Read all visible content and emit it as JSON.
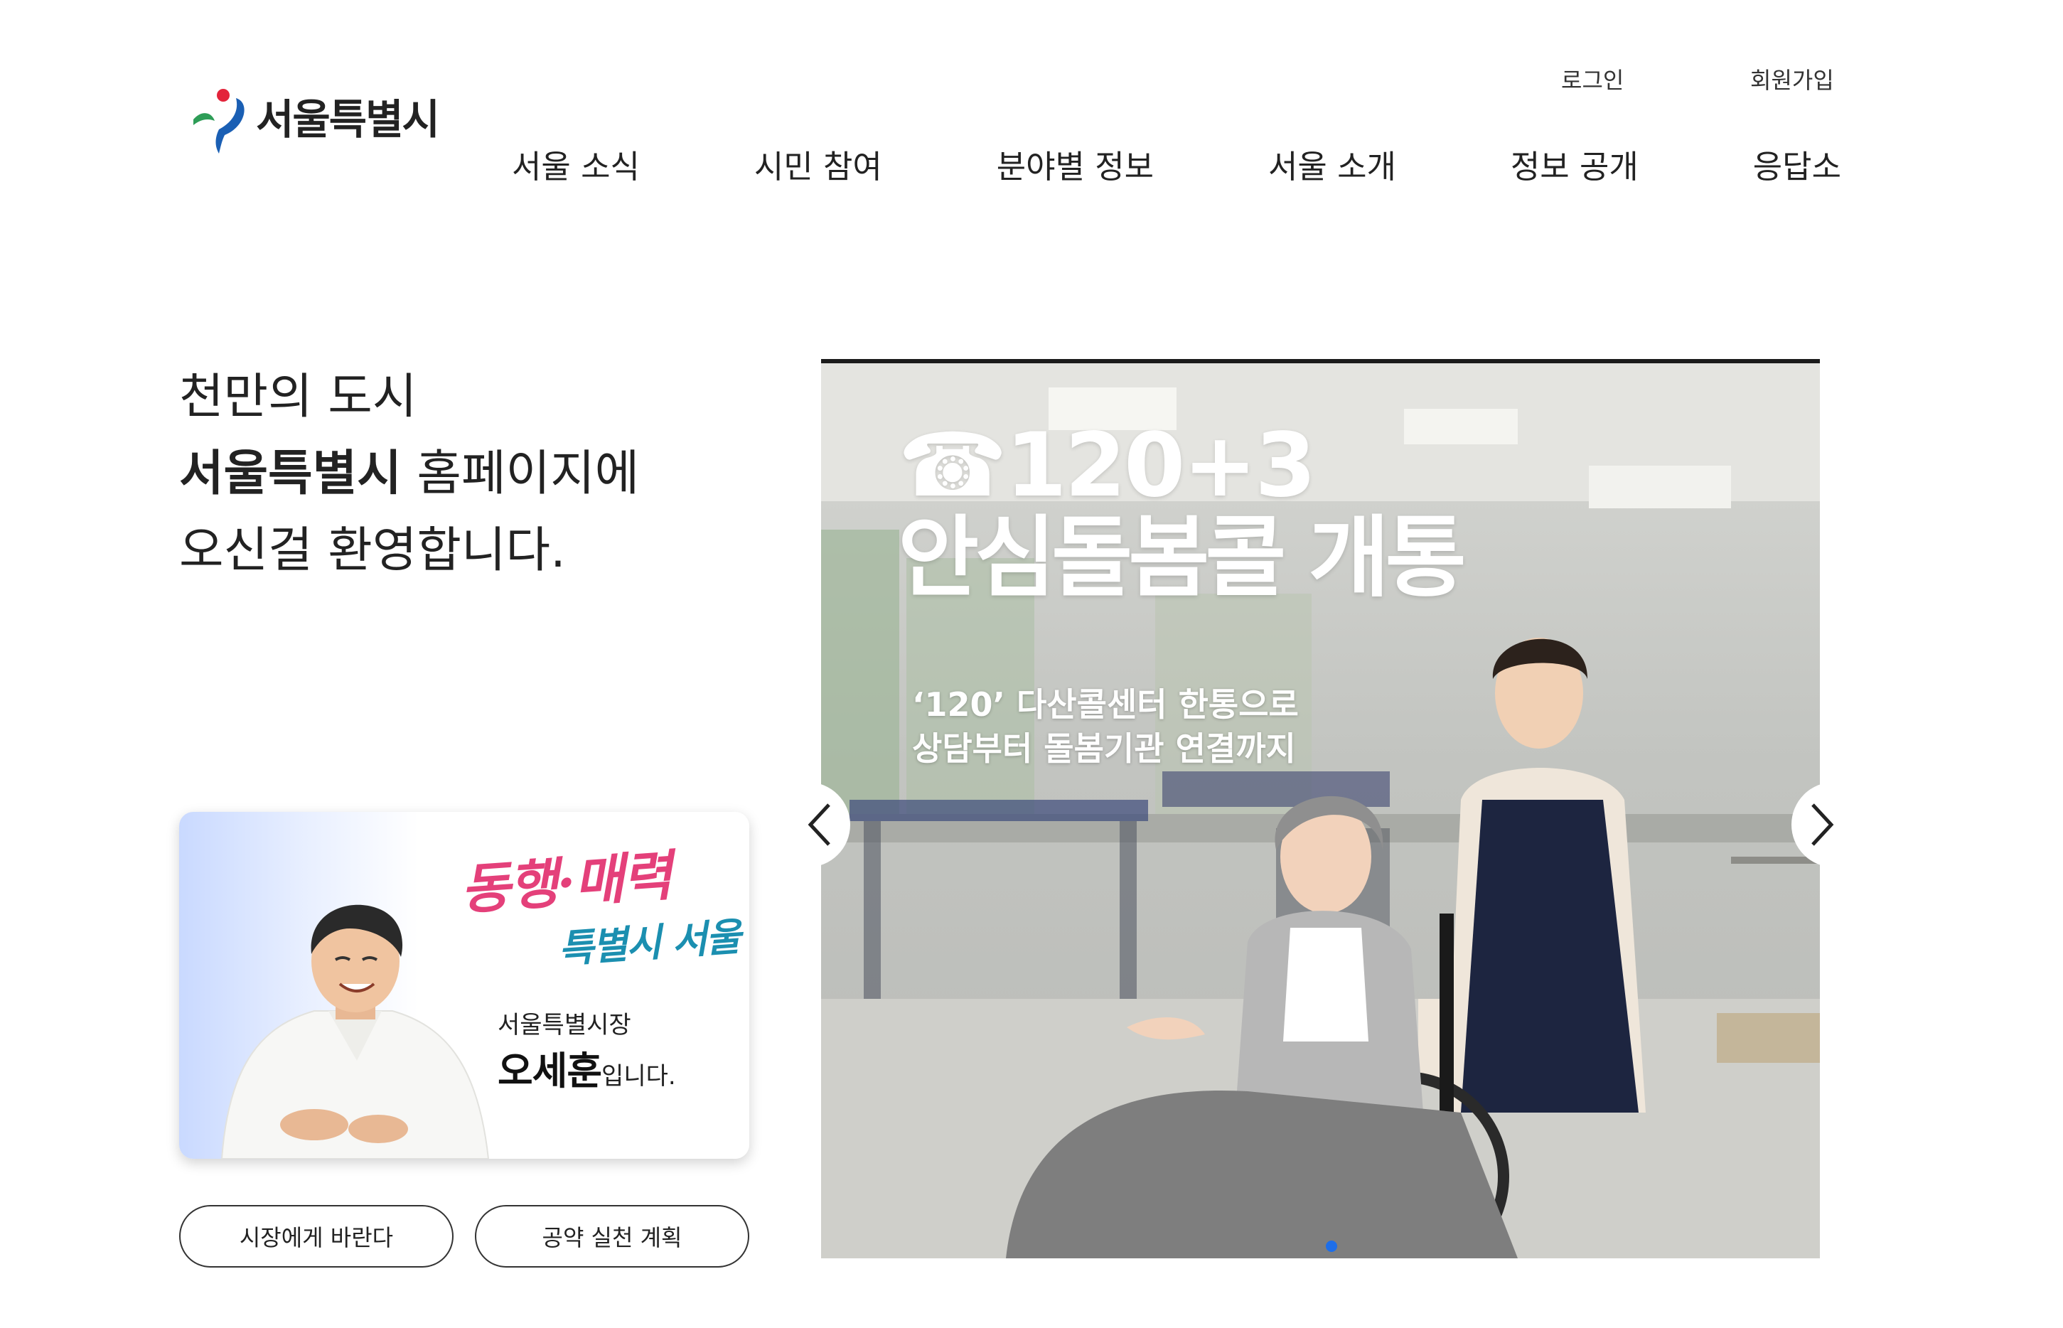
{
  "header": {
    "logo_text": "서울특별시",
    "utility_links": {
      "login": "로그인",
      "join": "회원가입"
    },
    "nav": [
      "서울 소식",
      "시민 참여",
      "분야별 정보",
      "서울 소개",
      "정보 공개",
      "응답소"
    ]
  },
  "welcome": {
    "line1": "천만의 도시",
    "line2_bold": "서울특별시",
    "line2_rest": " 홈페이지에",
    "line3": "오신걸 환영합니다."
  },
  "mayor_card": {
    "slogan_line1": "동행·매력",
    "slogan_line2": "특별시 서울",
    "title": "서울특별시장",
    "name": "오세훈",
    "name_suffix": "입니다."
  },
  "buttons": {
    "mayor_suggest": "시장에게 바란다",
    "pledge_plan": "공약 실천 계획"
  },
  "banner": {
    "title_line1": "☎120+3",
    "title_line2": "안심돌봄콜 개통",
    "sub_line1": "‘120’ 다산콜센터 한통으로",
    "sub_line2": "상담부터 돌봄기관 연결까지",
    "active_slide_indicator_color": "#1e6ee8"
  },
  "icons": {
    "prev": "chevron-left-icon",
    "next": "chevron-right-icon",
    "logo": "seoul-logo-icon"
  },
  "colors": {
    "slogan_pink": "#e4407a",
    "slogan_teal": "#1b8fb0",
    "text": "#222222"
  }
}
